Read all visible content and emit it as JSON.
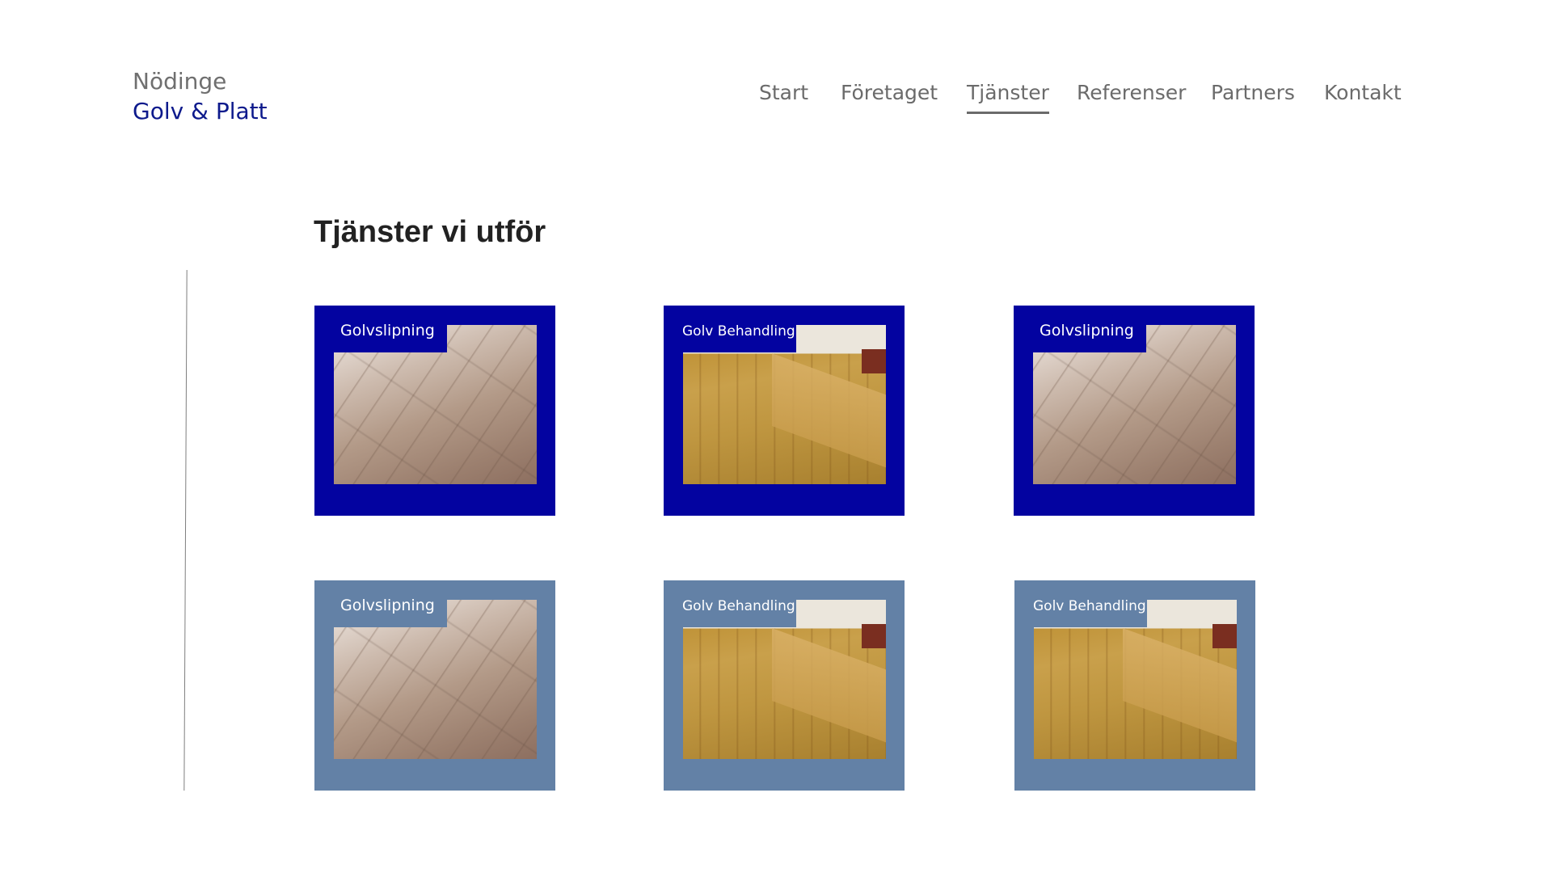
{
  "logo": {
    "line1": "Nödinge",
    "line2": "Golv & Platt"
  },
  "nav": {
    "items": [
      {
        "label": "Start"
      },
      {
        "label": "Företaget"
      },
      {
        "label": "Tjänster",
        "active": true
      },
      {
        "label": "Referenser"
      },
      {
        "label": "Partners"
      },
      {
        "label": "Kontakt"
      }
    ]
  },
  "main": {
    "heading": "Tjänster vi utför",
    "cards": [
      {
        "label": "Golvslipning",
        "style": "dark",
        "image": "floor-light"
      },
      {
        "label": "Golv Behandling",
        "style": "dark",
        "image": "floor-warm"
      },
      {
        "label": "Golvslipning",
        "style": "dark",
        "image": "floor-light"
      },
      {
        "label": "Golvslipning",
        "style": "light",
        "image": "floor-light"
      },
      {
        "label": "Golv Behandling",
        "style": "light",
        "image": "floor-warm"
      },
      {
        "label": "Golv Behandling",
        "style": "light",
        "image": "floor-warm"
      }
    ]
  },
  "colors": {
    "accent": "#0303a0",
    "card_light": "#6381a6",
    "logo_blue": "#0d1a8c"
  }
}
